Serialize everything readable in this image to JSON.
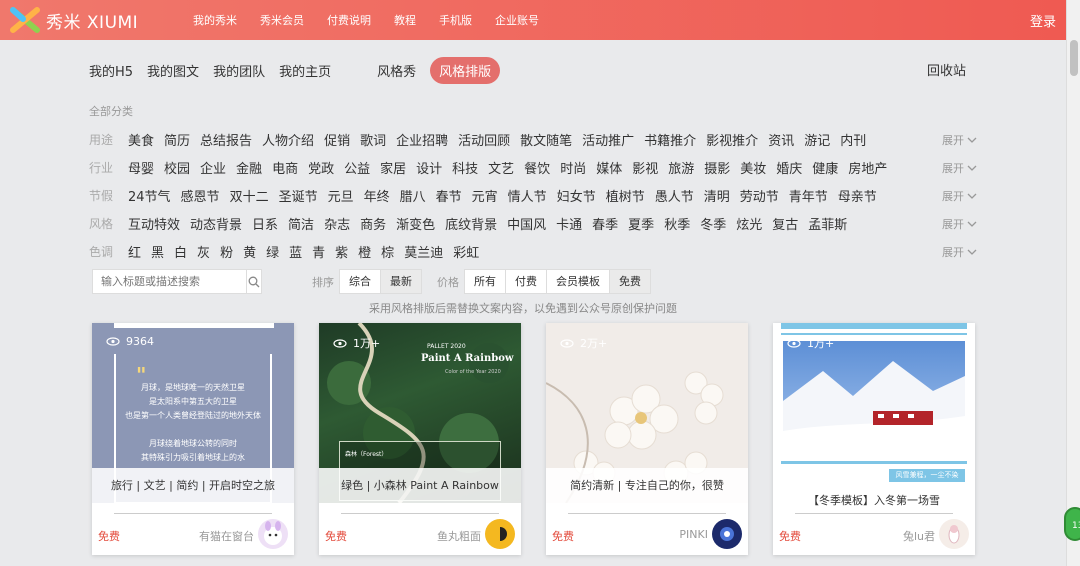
{
  "header": {
    "brand": "秀米 XIUMI",
    "nav": [
      "我的秀米",
      "秀米会员",
      "付费说明",
      "教程",
      "手机版",
      "企业账号"
    ],
    "login": "登录"
  },
  "tabs": [
    "我的H5",
    "我的图文",
    "我的团队",
    "我的主页"
  ],
  "tabs_right": [
    "风格秀",
    "风格排版"
  ],
  "recycle": "回收站",
  "all_categories": "全部分类",
  "category_rows": [
    {
      "label": "用途",
      "items": [
        "美食",
        "简历",
        "总结报告",
        "人物介绍",
        "促销",
        "歌词",
        "企业招聘",
        "活动回顾",
        "散文随笔",
        "活动推广",
        "书籍推介",
        "影视推介",
        "资讯",
        "游记",
        "内刊"
      ]
    },
    {
      "label": "行业",
      "items": [
        "母婴",
        "校园",
        "企业",
        "金融",
        "电商",
        "党政",
        "公益",
        "家居",
        "设计",
        "科技",
        "文艺",
        "餐饮",
        "时尚",
        "媒体",
        "影视",
        "旅游",
        "摄影",
        "美妆",
        "婚庆",
        "健康",
        "房地产"
      ]
    },
    {
      "label": "节假",
      "items": [
        "24节气",
        "感恩节",
        "双十二",
        "圣诞节",
        "元旦",
        "年终",
        "腊八",
        "春节",
        "元宵",
        "情人节",
        "妇女节",
        "植树节",
        "愚人节",
        "清明",
        "劳动节",
        "青年节",
        "母亲节"
      ]
    },
    {
      "label": "风格",
      "items": [
        "互动特效",
        "动态背景",
        "日系",
        "简洁",
        "杂志",
        "商务",
        "渐变色",
        "底纹背景",
        "中国风",
        "卡通",
        "春季",
        "夏季",
        "秋季",
        "冬季",
        "炫光",
        "复古",
        "孟菲斯"
      ]
    },
    {
      "label": "色调",
      "items": [
        "红",
        "黑",
        "白",
        "灰",
        "粉",
        "黄",
        "绿",
        "蓝",
        "青",
        "紫",
        "橙",
        "棕",
        "莫兰迪",
        "彩虹"
      ]
    }
  ],
  "expand_label": "展开",
  "search": {
    "placeholder": "输入标题或描述搜索"
  },
  "sort": {
    "label": "排序",
    "options": [
      "综合",
      "最新"
    ],
    "selected": "最新"
  },
  "price": {
    "label": "价格",
    "options": [
      "所有",
      "付费",
      "会员模板",
      "免费"
    ],
    "selected": "免费"
  },
  "notice": "采用风格排版后需替换文案内容，以免遇到公众号原创保护问题",
  "cards": [
    {
      "views": "9364",
      "title": "旅行 | 文艺 | 简约 | 开启时空之旅",
      "price": "免费",
      "author": "有猫在窗台",
      "poem": [
        "月球，是地球唯一的天然卫星",
        "是太阳系中第五大的卫星",
        "也是第一个人类曾经登陆过的地外天体",
        "",
        "月球绕着地球公转的同时",
        "其特殊引力吸引着地球上的水"
      ]
    },
    {
      "views": "1万+",
      "title": "绿色 | 小森林 Paint A Rainbow",
      "price": "免费",
      "author": "鱼丸粗面",
      "pallet": "PALLET 2020",
      "headline": "Paint A Rainbow",
      "sub": "Color of the Year 2020",
      "forest": "森林（Forest）"
    },
    {
      "views": "2万+",
      "title": "简约清新 | 专注自己的你，很赞",
      "price": "免费",
      "author": "PINKI"
    },
    {
      "views": "1万+",
      "title": "【冬季模板】入冬第一场雪",
      "price": "免费",
      "author": "兔lu君",
      "tag": "风雪兼程，一尘不染"
    }
  ],
  "float_badge": "13",
  "colors": {
    "brand": "#ef5a52",
    "active_tab": "#e46f6c",
    "free": "#e34b3c"
  }
}
